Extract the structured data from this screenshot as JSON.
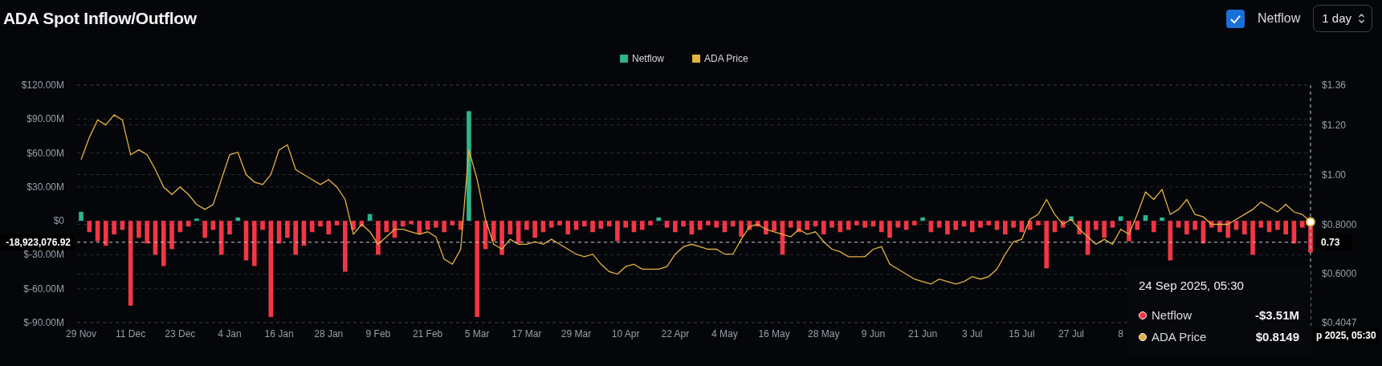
{
  "title": "ADA Spot Inflow/Outflow",
  "netflow_toggle": {
    "label": "Netflow",
    "checked": true
  },
  "interval": {
    "value": "1 day"
  },
  "chart": {
    "chart_data": {
      "type": "bar",
      "categories": [
        "29 Nov",
        null,
        null,
        null,
        null,
        null,
        "11 Dec",
        null,
        null,
        null,
        null,
        null,
        "23 Dec",
        null,
        null,
        null,
        null,
        null,
        "4 Jan",
        null,
        null,
        null,
        null,
        null,
        "16 Jan",
        null,
        null,
        null,
        null,
        null,
        "28 Jan",
        null,
        null,
        null,
        null,
        null,
        "9 Feb",
        null,
        null,
        null,
        null,
        null,
        "21 Feb",
        null,
        null,
        null,
        null,
        null,
        "5 Mar",
        null,
        null,
        null,
        null,
        null,
        "17 Mar",
        null,
        null,
        null,
        null,
        null,
        "29 Mar",
        null,
        null,
        null,
        null,
        null,
        "10 Apr",
        null,
        null,
        null,
        null,
        null,
        "22 Apr",
        null,
        null,
        null,
        null,
        null,
        "4 May",
        null,
        null,
        null,
        null,
        null,
        "16 May",
        null,
        null,
        null,
        null,
        null,
        "28 May",
        null,
        null,
        null,
        null,
        null,
        "9 Jun",
        null,
        null,
        null,
        null,
        null,
        "21 Jun",
        null,
        null,
        null,
        null,
        null,
        "3 Jul",
        null,
        null,
        null,
        null,
        null,
        "15 Jul",
        null,
        null,
        null,
        null,
        null,
        "27 Jul",
        null,
        null,
        null,
        null,
        null,
        "8",
        null,
        null,
        null,
        null,
        null,
        null,
        null,
        null,
        null,
        null,
        null,
        null,
        null,
        null,
        null,
        null,
        null,
        null,
        null,
        null,
        null,
        null,
        null
      ],
      "series": [
        {
          "name": "Netflow",
          "color": "#2bb58c",
          "values": [
            8,
            null,
            null,
            null,
            null,
            null,
            null,
            null,
            null,
            null,
            null,
            null,
            null,
            null,
            2,
            null,
            null,
            null,
            null,
            3,
            null,
            null,
            null,
            null,
            null,
            null,
            null,
            null,
            null,
            null,
            null,
            null,
            null,
            null,
            null,
            6,
            null,
            null,
            null,
            null,
            null,
            null,
            null,
            null,
            null,
            null,
            null,
            97,
            null,
            null,
            null,
            null,
            null,
            null,
            null,
            null,
            null,
            null,
            null,
            null,
            null,
            null,
            null,
            null,
            null,
            null,
            null,
            null,
            null,
            null,
            3,
            null,
            null,
            null,
            null,
            null,
            null,
            null,
            null,
            null,
            null,
            null,
            null,
            null,
            null,
            null,
            null,
            null,
            null,
            null,
            null,
            null,
            null,
            null,
            null,
            null,
            null,
            null,
            null,
            null,
            null,
            null,
            3,
            null,
            null,
            null,
            null,
            null,
            null,
            null,
            null,
            null,
            null,
            null,
            null,
            null,
            null,
            null,
            null,
            null,
            4,
            null,
            null,
            null,
            null,
            null,
            4,
            null,
            null,
            5,
            null,
            3,
            null,
            null,
            null,
            null,
            null,
            null,
            null,
            null,
            null,
            null,
            null,
            null,
            null,
            null,
            null,
            null,
            null,
            null
          ]
        },
        {
          "color": "#f23645",
          "values": [
            null,
            -10,
            -18,
            -22,
            -12,
            -8,
            -75,
            -15,
            -20,
            -30,
            -40,
            -25,
            -10,
            -5,
            null,
            -15,
            -8,
            -30,
            -12,
            null,
            -35,
            -40,
            -8,
            -85,
            -20,
            -15,
            -30,
            -22,
            -10,
            -5,
            -12,
            -4,
            -45,
            -8,
            -5,
            null,
            -30,
            -10,
            -15,
            -5,
            -3,
            -12,
            -8,
            -6,
            -10,
            -4,
            -8,
            null,
            -85,
            -25,
            -18,
            -30,
            -12,
            -20,
            -8,
            -15,
            -10,
            -6,
            -4,
            -12,
            -8,
            -5,
            -10,
            -7,
            -5,
            -18,
            -6,
            -10,
            -8,
            -4,
            null,
            -6,
            -10,
            -5,
            -12,
            -8,
            -4,
            -6,
            -10,
            -5,
            -14,
            -8,
            -5,
            -12,
            -9,
            -30,
            -6,
            -10,
            -8,
            -5,
            -12,
            -6,
            -10,
            -8,
            -4,
            -6,
            -5,
            -10,
            -15,
            -6,
            -8,
            -4,
            null,
            -10,
            -6,
            -12,
            -8,
            -5,
            -10,
            -6,
            -4,
            -8,
            -12,
            -6,
            -10,
            -8,
            -4,
            -42,
            -10,
            -6,
            null,
            -12,
            -30,
            -8,
            -15,
            -6,
            null,
            -18,
            -8,
            null,
            -10,
            null,
            -35,
            -6,
            -12,
            -8,
            -20,
            -6,
            -10,
            -15,
            -8,
            -12,
            -30,
            -6,
            -10,
            -8,
            -12,
            -20,
            -6,
            -28
          ]
        },
        {
          "name": "ADA Price",
          "type": "line",
          "axis": "y2",
          "color": "#e3b341",
          "values": [
            1.06,
            1.15,
            1.22,
            1.2,
            1.24,
            1.22,
            1.08,
            1.1,
            1.08,
            1.02,
            0.95,
            0.92,
            0.95,
            0.92,
            0.88,
            0.86,
            0.88,
            0.98,
            1.08,
            1.09,
            1.0,
            0.97,
            0.96,
            1.0,
            1.1,
            1.12,
            1.02,
            1.0,
            0.98,
            0.96,
            0.98,
            0.95,
            0.9,
            0.76,
            0.8,
            0.77,
            0.72,
            0.75,
            0.78,
            0.78,
            0.77,
            0.76,
            0.77,
            0.75,
            0.66,
            0.64,
            0.7,
            1.1,
            0.98,
            0.82,
            0.72,
            0.7,
            0.74,
            0.72,
            0.72,
            0.73,
            0.72,
            0.74,
            0.72,
            0.7,
            0.68,
            0.67,
            0.68,
            0.64,
            0.61,
            0.6,
            0.63,
            0.64,
            0.62,
            0.62,
            0.62,
            0.63,
            0.68,
            0.71,
            0.72,
            0.71,
            0.7,
            0.7,
            0.68,
            0.68,
            0.74,
            0.79,
            0.8,
            0.78,
            0.77,
            0.76,
            0.75,
            0.78,
            0.76,
            0.77,
            0.73,
            0.7,
            0.69,
            0.67,
            0.67,
            0.67,
            0.7,
            0.71,
            0.64,
            0.62,
            0.6,
            0.58,
            0.57,
            0.56,
            0.58,
            0.57,
            0.56,
            0.57,
            0.59,
            0.58,
            0.59,
            0.62,
            0.68,
            0.73,
            0.74,
            0.82,
            0.84,
            0.9,
            0.84,
            0.8,
            0.82,
            0.78,
            0.75,
            0.72,
            0.74,
            0.72,
            0.78,
            0.76,
            0.84,
            0.93,
            0.9,
            0.94,
            0.84,
            0.86,
            0.9,
            0.84,
            0.83,
            0.8,
            0.8,
            0.8,
            0.82,
            0.84,
            0.86,
            0.89,
            0.87,
            0.85,
            0.88,
            0.85,
            0.84,
            0.81
          ]
        }
      ],
      "legend": "upper center",
      "grid": true,
      "ref_lines": [
        {
          "axis": "y",
          "value": -18.92
        }
      ],
      "ylim": [
        -90,
        120
      ],
      "yticks": [
        {
          "value": 120,
          "label": "$120.00M"
        },
        {
          "value": 90,
          "label": "$90.00M"
        },
        {
          "value": 60,
          "label": "$60.00M"
        },
        {
          "value": 30,
          "label": "$30.00M"
        },
        {
          "value": 0,
          "label": "$0"
        },
        {
          "value": -30,
          "label": "$-30.00M"
        },
        {
          "value": -60,
          "label": "$-60.00M"
        },
        {
          "value": -90,
          "label": "$-90.00M"
        }
      ],
      "y2lim": [
        0.4047,
        1.36
      ],
      "y2ticks": [
        {
          "value": 1.36,
          "label": "$1.36"
        },
        {
          "value": 1.2,
          "label": "$1.20"
        },
        {
          "value": 1.0,
          "label": "$1.00"
        },
        {
          "value": 0.8,
          "label": "$0.8000"
        },
        {
          "value": 0.6,
          "label": "$0.6000"
        },
        {
          "value": 0.4047,
          "label": "$0.4047"
        }
      ]
    }
  },
  "crosshair": {
    "left_label": "-18,923,076.92",
    "right_label": "0.73",
    "x_label": "p 2025, 05:30"
  },
  "tooltip": {
    "title": "24 Sep 2025, 05:30",
    "rows": [
      {
        "label": "Netflow",
        "value": "-$3.51M",
        "color": "#f23645"
      },
      {
        "label": "ADA Price",
        "value": "$0.8149",
        "color": "#e3b341"
      }
    ]
  }
}
